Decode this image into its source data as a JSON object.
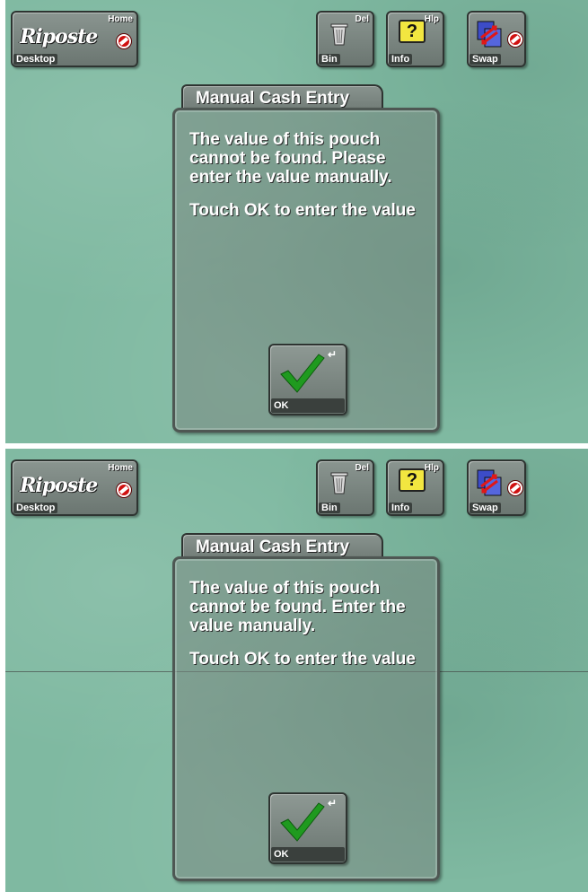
{
  "toolbar": {
    "desktop": {
      "label": "Desktop",
      "key": "Home",
      "logo": "Riposte"
    },
    "bin": {
      "label": "Bin",
      "key": "Del"
    },
    "info": {
      "label": "Info",
      "key": "Hlp",
      "icon_text": "?"
    },
    "swap": {
      "label": "Swap"
    }
  },
  "screens": [
    {
      "dialog_title": "Manual Cash Entry",
      "message_1": "The value of this pouch cannot be found.  Please enter the value manually.",
      "message_2": "Touch OK to enter the value",
      "ok_label": "OK"
    },
    {
      "dialog_title": "Manual Cash Entry",
      "message_1": "The value of this pouch cannot be found.  Enter the value manually.",
      "message_2": "Touch OK to enter the value",
      "ok_label": "OK"
    }
  ],
  "colors": {
    "background": "#7fb9a1",
    "button_face": "#7b8681",
    "label_bar": "#3a403d",
    "check_green": "#1f9a1f",
    "no_sign_red": "#d01010",
    "help_yellow": "#f2e640"
  }
}
